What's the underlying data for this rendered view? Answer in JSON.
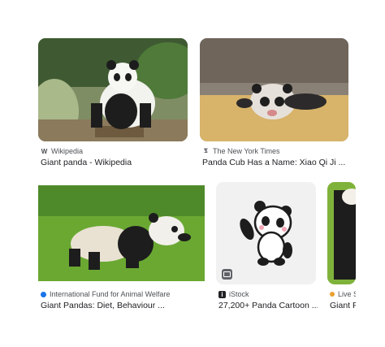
{
  "results": [
    {
      "source": "Wikipedia",
      "title": "Giant panda - Wikipedia",
      "icon": "wikipedia-icon"
    },
    {
      "source": "The New York Times",
      "title": "Panda Cub Has a Name: Xiao Qi Ji ...",
      "icon": "nyt-icon"
    },
    {
      "source": "International Fund for Animal Welfare",
      "title": "Giant Pandas: Diet, Behaviour ...",
      "icon": "ifaw-icon"
    },
    {
      "source": "iStock",
      "title": "27,200+ Panda Cartoon ...",
      "icon": "istock-icon"
    },
    {
      "source": "Live S",
      "title": "Giant F",
      "icon": "livescience-icon"
    }
  ],
  "icon_glyphs": {
    "wikipedia": "W",
    "nyt": "𝕿",
    "istock": "i"
  },
  "colors": {
    "text": "#202124",
    "meta": "#4d5156",
    "grass": "#6aa832"
  }
}
